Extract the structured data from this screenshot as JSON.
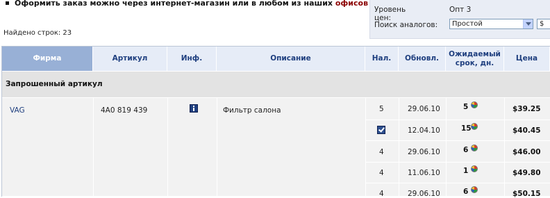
{
  "notice": {
    "text": "Оформить заказ можно через интернет-магазин или в любом из наших ",
    "link": "офисов"
  },
  "found_rows": "Найдено строк: 23",
  "panel": {
    "price_level_label": "Уровень цен:",
    "price_level_value": "Опт 3",
    "analog_search_label": "Поиск аналогов:",
    "analog_search_value": "Простой",
    "currency_value": "$"
  },
  "table": {
    "headers": {
      "firm": "Фирма",
      "article": "Артикул",
      "info": "Инф.",
      "description": "Описание",
      "stock": "Нал.",
      "updated": "Обновл.",
      "wait_days_line1": "Ожидаемый",
      "wait_days_line2": "срок, дн.",
      "price": "Цена"
    },
    "group_title": "Запрошенный артикул",
    "item": {
      "firm": "VAG",
      "article": "4A0 819 439",
      "description": "Фильтр салона"
    },
    "rows": [
      {
        "stock": "5",
        "updated": "29.06.10",
        "days": "5",
        "price": "$39.25"
      },
      {
        "stock": "",
        "stock_checked": true,
        "updated": "12.04.10",
        "days": "15",
        "price": "$40.45"
      },
      {
        "stock": "4",
        "updated": "29.06.10",
        "days": "6",
        "price": "$46.00"
      },
      {
        "stock": "4",
        "updated": "11.06.10",
        "days": "1",
        "price": "$49.80"
      },
      {
        "stock": "4",
        "updated": "29.06.10",
        "days": "6",
        "price": "$50.15"
      }
    ]
  }
}
